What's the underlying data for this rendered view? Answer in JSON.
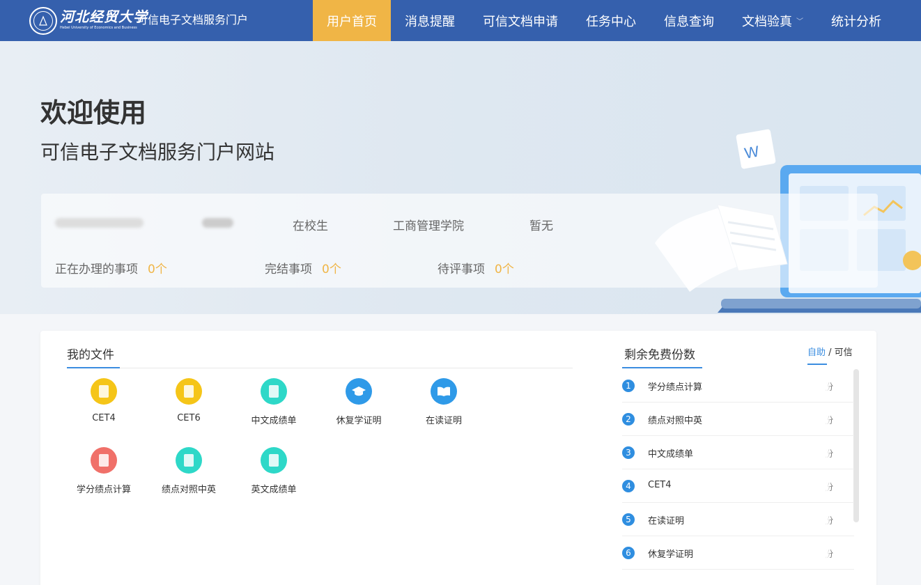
{
  "header": {
    "univ_cn": "河北经贸大学",
    "univ_en": "Hebei University of Economics and Business",
    "portal_title": "可信电子文档服务门户",
    "nav": [
      "用户首页",
      "消息提醒",
      "可信文档申请",
      "任务中心",
      "信息查询",
      "文档验真",
      "统计分析"
    ],
    "active_index": 0
  },
  "banner": {
    "welcome": "欢迎使用",
    "subtitle": "可信电子文档服务门户网站",
    "user": {
      "status": "在校生",
      "college": "工商管理学院",
      "extra": "暂无"
    },
    "stats": [
      {
        "label": "正在办理的事项",
        "value": "0个"
      },
      {
        "label": "完结事项",
        "value": "0个"
      },
      {
        "label": "待评事项",
        "value": "0个"
      }
    ]
  },
  "files": {
    "title": "我的文件",
    "items": [
      {
        "label": "CET4",
        "color": "#f5c518"
      },
      {
        "label": "CET6",
        "color": "#f5c518"
      },
      {
        "label": "中文成绩单",
        "color": "#2ed8c8"
      },
      {
        "label": "休复学证明",
        "color": "#2f9ae8"
      },
      {
        "label": "在读证明",
        "color": "#2f9ae8"
      },
      {
        "label": "学分绩点计算",
        "color": "#f07069"
      },
      {
        "label": "绩点对照中英",
        "color": "#2ed8c8"
      },
      {
        "label": "英文成绩单",
        "color": "#2ed8c8"
      }
    ]
  },
  "free": {
    "title": "剩余免费份数",
    "toggle_self": "自助",
    "toggle_sep": " / ",
    "toggle_trust": "可信",
    "rows": [
      {
        "no": "1",
        "name": "学分绩点计算",
        "count": "份"
      },
      {
        "no": "2",
        "name": "绩点对照中英",
        "count": "份"
      },
      {
        "no": "3",
        "name": "中文成绩单",
        "count": "份"
      },
      {
        "no": "4",
        "name": "CET4",
        "count": "份"
      },
      {
        "no": "5",
        "name": "在读证明",
        "count": "份"
      },
      {
        "no": "6",
        "name": "休复学证明",
        "count": "份"
      }
    ]
  }
}
